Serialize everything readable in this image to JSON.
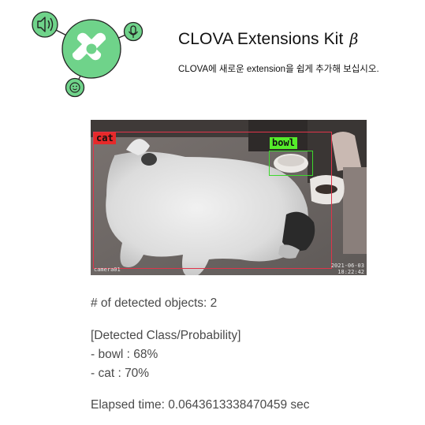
{
  "header": {
    "title": "CLOVA Extensions Kit",
    "title_symbol": "β",
    "subtitle": "CLOVA에 새로운 extension을 쉽게 추가해 보십시오."
  },
  "logo": {
    "center_icon": "clova-logo-icon",
    "satellite_icons": [
      "speaker-icon",
      "microphone-icon",
      "smile-icon"
    ],
    "accent_color": "#6fd38a"
  },
  "detection_image": {
    "boxes": [
      {
        "label": "cat",
        "color": "#e62a2a"
      },
      {
        "label": "bowl",
        "color": "#55ec2a"
      }
    ],
    "stamp_left": "camera01",
    "stamp_right_date": "2021-06-03",
    "stamp_right_time": "18:22:42"
  },
  "results": {
    "count_text": "# of detected objects: 2",
    "section_heading": "[Detected Class/Probability]",
    "items": [
      "- bowl : 68%",
      "- cat : 70%"
    ],
    "elapsed_text": "Elapsed time: 0.0643613338470459 sec"
  }
}
